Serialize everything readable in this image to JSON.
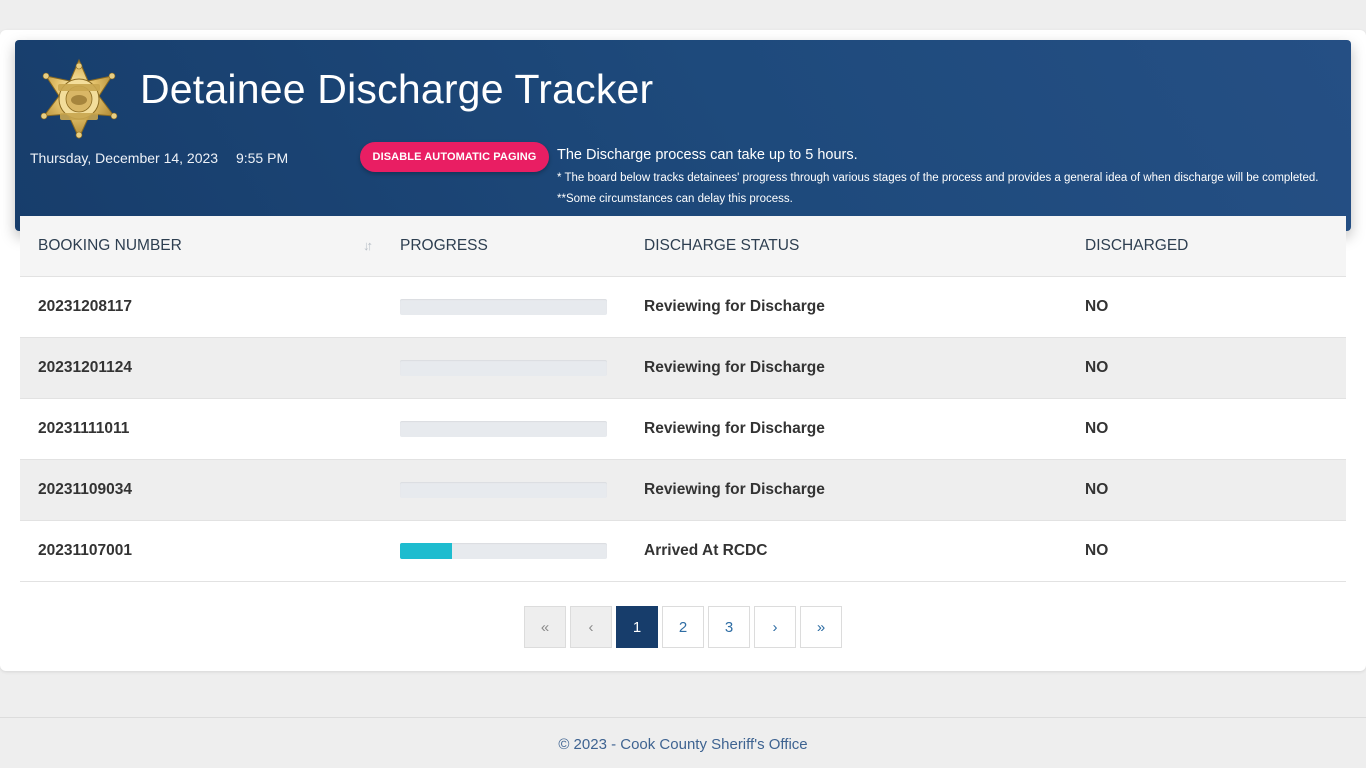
{
  "header": {
    "title": "Detainee Discharge Tracker",
    "date": "Thursday, December 14, 2023",
    "time": "9:55 PM",
    "paging_button_label": "DISABLE AUTOMATIC PAGING",
    "info_main": "The Discharge process can take up to 5 hours.",
    "info_note1": "* The board below tracks detainees' progress through various stages of the process and provides a general idea of when discharge will be completed.",
    "info_note2": "**Some circumstances can delay this process.",
    "badge_icon": "sheriff-star-badge",
    "badge_text": [
      "D.O.C.",
      "COOK COUNTY",
      "SHERIFF"
    ]
  },
  "table": {
    "columns": [
      "BOOKING NUMBER",
      "PROGRESS",
      "DISCHARGE STATUS",
      "DISCHARGED"
    ],
    "sort_icon": "sort-arrows-icon",
    "rows": [
      {
        "booking": "20231208117",
        "progress": 0,
        "status": "Reviewing for Discharge",
        "discharged": "NO"
      },
      {
        "booking": "20231201124",
        "progress": 0,
        "status": "Reviewing for Discharge",
        "discharged": "NO"
      },
      {
        "booking": "20231111011",
        "progress": 0,
        "status": "Reviewing for Discharge",
        "discharged": "NO"
      },
      {
        "booking": "20231109034",
        "progress": 0,
        "status": "Reviewing for Discharge",
        "discharged": "NO"
      },
      {
        "booking": "20231107001",
        "progress": 0.25,
        "status": "Arrived At RCDC",
        "discharged": "NO"
      }
    ]
  },
  "pagination": {
    "first": "«",
    "prev": "‹",
    "pages": [
      "1",
      "2",
      "3"
    ],
    "next": "›",
    "last": "»",
    "current": "1"
  },
  "footer": {
    "text": "© 2023 - Cook County Sheriff's Office"
  },
  "colors": {
    "header_bg": "#1e4a7c",
    "accent_button": "#e91e63",
    "progress_fill": "#1ebccf",
    "active_page": "#173d6b"
  }
}
